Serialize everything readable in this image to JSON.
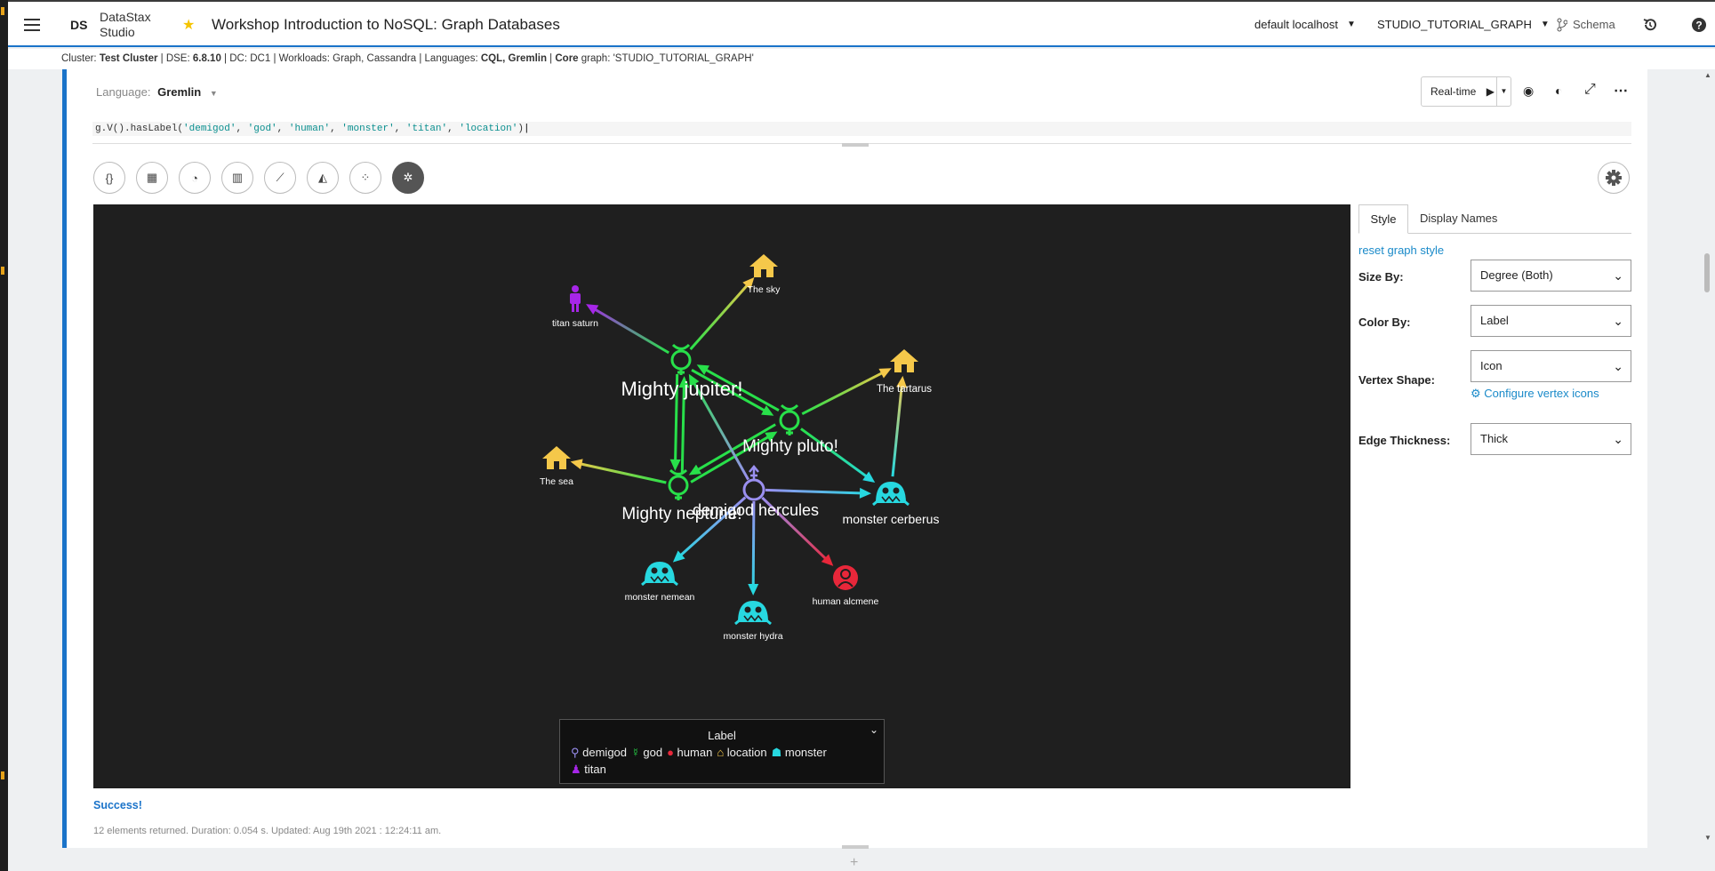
{
  "app": {
    "logo": "DS",
    "name_line1": "DataStax",
    "name_line2": "Studio",
    "notebook_title": "Workshop Introduction to NoSQL: Graph Databases"
  },
  "topbar": {
    "connection": "default localhost",
    "graph": "STUDIO_TUTORIAL_GRAPH",
    "schema": "Schema"
  },
  "info": {
    "cluster_label": "Cluster:",
    "cluster": "Test Cluster",
    "dse_label": "DSE:",
    "dse": "6.8.10",
    "dc": "DC: DC1",
    "workloads": "Workloads: Graph, Cassandra",
    "languages_label": "Languages:",
    "languages": "CQL, Gremlin",
    "core_label": "Core",
    "core_graph": "graph: 'STUDIO_TUTORIAL_GRAPH'"
  },
  "cell": {
    "language_label": "Language:",
    "language": "Gremlin",
    "run_mode": "Real-time",
    "query": {
      "prefix": "g.V().hasLabel(",
      "args": [
        "'demigod'",
        "'god'",
        "'human'",
        "'monster'",
        "'titan'",
        "'location'"
      ],
      "suffix": ")"
    },
    "status": "Success!",
    "summary": "12 elements returned. Duration: 0.054 s. Updated: Aug 19th 2021 : 12:24:11 am."
  },
  "viz_buttons": [
    {
      "name": "json-view-button",
      "icon": "braces-icon",
      "glyph": "{}"
    },
    {
      "name": "table-view-button",
      "icon": "table-icon",
      "glyph": "▦"
    },
    {
      "name": "pie-chart-button",
      "icon": "pie-chart-icon",
      "glyph": "◔"
    },
    {
      "name": "bar-chart-button",
      "icon": "bar-chart-icon",
      "glyph": "▥"
    },
    {
      "name": "line-chart-button",
      "icon": "line-chart-icon",
      "glyph": "⟋"
    },
    {
      "name": "area-chart-button",
      "icon": "area-chart-icon",
      "glyph": "◭"
    },
    {
      "name": "scatter-chart-button",
      "icon": "scatter-icon",
      "glyph": "⁘"
    },
    {
      "name": "graph-view-button",
      "icon": "graph-icon",
      "glyph": "✲"
    }
  ],
  "graph": {
    "colors": {
      "demigod": "#9a8ff0",
      "god": "#28e04a",
      "human": "#e8273a",
      "location": "#f5c84a",
      "monster": "#27d8e0",
      "titan": "#a626e8"
    },
    "vertices": [
      {
        "id": "jupiter",
        "label": "Mighty jupiter!",
        "type": "god",
        "big": true
      },
      {
        "id": "pluto",
        "label": "Mighty pluto!",
        "type": "god",
        "big": true
      },
      {
        "id": "neptune",
        "label": "Mighty neptune!",
        "type": "god",
        "big": true
      },
      {
        "id": "hercules",
        "label": "demigod hercules",
        "type": "demigod",
        "big": true
      },
      {
        "id": "saturn",
        "label": "titan saturn",
        "type": "titan"
      },
      {
        "id": "sky",
        "label": "The sky",
        "type": "location"
      },
      {
        "id": "tartarus",
        "label": "The tartarus",
        "type": "location"
      },
      {
        "id": "sea",
        "label": "The sea",
        "type": "location"
      },
      {
        "id": "cerberus",
        "label": "monster cerberus",
        "type": "monster",
        "big": true
      },
      {
        "id": "nemean",
        "label": "monster nemean",
        "type": "monster"
      },
      {
        "id": "hydra",
        "label": "monster hydra",
        "type": "monster"
      },
      {
        "id": "alcmene",
        "label": "human alcmene",
        "type": "human"
      }
    ],
    "edges": [
      [
        "jupiter",
        "saturn"
      ],
      [
        "jupiter",
        "sky"
      ],
      [
        "jupiter",
        "neptune"
      ],
      [
        "jupiter",
        "pluto"
      ],
      [
        "pluto",
        "jupiter"
      ],
      [
        "pluto",
        "neptune"
      ],
      [
        "pluto",
        "tartarus"
      ],
      [
        "pluto",
        "cerberus"
      ],
      [
        "neptune",
        "jupiter"
      ],
      [
        "neptune",
        "pluto"
      ],
      [
        "neptune",
        "sea"
      ],
      [
        "hercules",
        "jupiter"
      ],
      [
        "hercules",
        "cerberus"
      ],
      [
        "hercules",
        "nemean"
      ],
      [
        "hercules",
        "hydra"
      ],
      [
        "hercules",
        "alcmene"
      ],
      [
        "cerberus",
        "tartarus"
      ]
    ]
  },
  "legend": {
    "title": "Label",
    "items": [
      {
        "type": "demigod",
        "text": "demigod"
      },
      {
        "type": "god",
        "text": "god"
      },
      {
        "type": "human",
        "text": "human"
      },
      {
        "type": "location",
        "text": "location"
      },
      {
        "type": "monster",
        "text": "monster"
      },
      {
        "type": "titan",
        "text": "titan"
      }
    ]
  },
  "panel": {
    "tabs": [
      "Style",
      "Display Names"
    ],
    "reset": "reset graph style",
    "size_by_label": "Size By:",
    "size_by": "Degree (Both)",
    "color_by_label": "Color By:",
    "color_by": "Label",
    "shape_label": "Vertex Shape:",
    "shape": "Icon",
    "configure": "Configure vertex icons",
    "thickness_label": "Edge Thickness:",
    "thickness": "Thick"
  }
}
